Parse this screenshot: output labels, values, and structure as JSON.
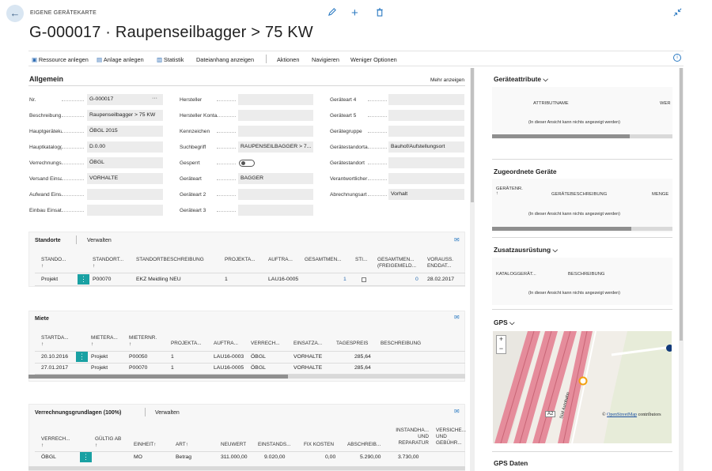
{
  "header": {
    "card_label": "EIGENE GERÄTEKARTE",
    "title": "G-000017 · Raupenseilbagger > 75 KW"
  },
  "icons": {
    "back": "back-arrow-icon",
    "edit": "pencil-icon",
    "add": "plus-icon",
    "delete": "trash-icon",
    "collapse": "collapse-icon",
    "info": "info-icon"
  },
  "commands": {
    "c1": "Ressource anlegen",
    "c2": "Anlage anlegen",
    "c3": "Statistik",
    "c4": "Dateianhang anzeigen",
    "c5": "Aktionen",
    "c6": "Navigieren",
    "c7": "Weniger Optionen"
  },
  "allgemein": {
    "title": "Allgemein",
    "more": "Mehr anzeigen",
    "col1": [
      {
        "label": "Nr.",
        "value": "G-000017",
        "dots": "···"
      },
      {
        "label": "Beschreibung",
        "value": "Raupenseilbagger > 75 KW"
      },
      {
        "label": "Hauptgerätekatal...",
        "value": "ÖBGL 2015"
      },
      {
        "label": "Hauptkataloggerr...",
        "value": "D.0.00"
      },
      {
        "label": "Verrechnungsmet...",
        "value": "ÖBGL"
      },
      {
        "label": "Versand Einsatzar...",
        "value": "VORHALTE"
      },
      {
        "label": "Aufwand Einsatza...",
        "value": ""
      },
      {
        "label": "Einbau Einsatzart...",
        "value": ""
      }
    ],
    "col2": [
      {
        "label": "Hersteller",
        "value": ""
      },
      {
        "label": "Hersteller Kontakt...",
        "value": ""
      },
      {
        "label": "Kennzeichen",
        "value": ""
      },
      {
        "label": "Suchbegriff",
        "value": "RAUPENSEILBAGGER > 7..."
      },
      {
        "label": "Gesperrt",
        "value": ""
      },
      {
        "label": "Geräteart",
        "value": "BAGGER"
      },
      {
        "label": "Geräteart 2",
        "value": ""
      },
      {
        "label": "Geräteart 3",
        "value": ""
      }
    ],
    "col3": [
      {
        "label": "Geräteart 4",
        "value": ""
      },
      {
        "label": "Geräteart 5",
        "value": ""
      },
      {
        "label": "Gerätegruppe",
        "value": ""
      },
      {
        "label": "Gerätestandortart",
        "value": "Bauhof/Aufstellungsort"
      },
      {
        "label": "Gerätestandort",
        "value": ""
      },
      {
        "label": "Verantwortlicher ...",
        "value": ""
      },
      {
        "label": "Abrechnungsart",
        "value": "Vorhalt"
      }
    ]
  },
  "standorte": {
    "title": "Standorte",
    "manage": "Verwalten",
    "headers": [
      "STANDO...",
      "STANDORT...",
      "STANDORTBESCHREIBUNG",
      "PROJEKTA...",
      "AUFTRA...",
      "GESAMTMEN...",
      "STI...",
      "GESAMTMEN... (FREIGEMELD...",
      "VORAUSS. ENDDAT..."
    ],
    "arrow": "↑",
    "row": {
      "c1": "Projekt",
      "c2": "P00070",
      "c3": "EKZ Meidling NEU",
      "c4": "1",
      "c5": "LAU16-0005",
      "c6": "1",
      "c8": "0",
      "c9": "28.02.2017"
    }
  },
  "miete": {
    "title": "Miete",
    "headers": [
      "STARTDA...",
      "MIETERA...",
      "MIETERNR.",
      "PROJEKTA...",
      "AUFTRA...",
      "VERRECH...",
      "EINSATZA...",
      "TAGESPREIS",
      "BESCHREIBUNG"
    ],
    "rows": [
      {
        "c1": "20.10.2016",
        "c2": "Projekt",
        "c3": "P00050",
        "c4": "1",
        "c5": "LAU16-0003",
        "c6": "ÖBGL",
        "c7": "VORHALTE",
        "c8": "285,64"
      },
      {
        "c1": "27.01.2017",
        "c2": "Projekt",
        "c3": "P00070",
        "c4": "1",
        "c5": "LAU16-0005",
        "c6": "ÖBGL",
        "c7": "VORHALTE",
        "c8": "285,64"
      }
    ]
  },
  "verrechnung": {
    "title": "Verrechnungsgrundlagen (100%)",
    "manage": "Verwalten",
    "headers": [
      "VERRECH...",
      "GÜLTIG AB",
      "EINHEIT",
      "ART",
      "NEUWERT",
      "EINSTANDS...",
      "FIX KOSTEN",
      "ABSCHREIB...",
      "INSTANDHA... UND REPARATUR",
      "VERSICHE... UND GEBÜHR..."
    ],
    "row": {
      "c1": "ÖBGL",
      "c3": "MO",
      "c4": "Betrag",
      "c5": "311.000,00",
      "c6": "9.020,00",
      "c7": "0,00",
      "c8": "5.290,00",
      "c9": "3.730,00"
    }
  },
  "right": {
    "attrib": {
      "title": "Geräteattribute",
      "col1": "ATTRIBUTNAME",
      "col2": "WER",
      "note": "(In dieser Ansicht kann nichts angezeigt werden)"
    },
    "zugeordnet": {
      "title": "Zugeordnete Geräte",
      "col1": "GERÄTENR.",
      "col2": "GERÄTEBESCHREIBUNG",
      "col3": "MENGE",
      "note": "(In dieser Ansicht kann nichts angezeigt werden)"
    },
    "zusatz": {
      "title": "Zusatzausrüstung",
      "col1": "KATALOGGERÄT...",
      "col2": "BESCHREIBUNG",
      "note": "(In dieser Ansicht kann nichts angezeigt werden)"
    },
    "gps": {
      "title": "GPS",
      "zoom_in": "+",
      "zoom_out": "−",
      "label_a2": "A2",
      "label_road": "Süd Autobahn",
      "credit_link": "OpenStreetMap",
      "credit_rest": " contributors",
      "credit_symbol": "©"
    },
    "gpsdaten": {
      "title": "GPS Daten"
    }
  }
}
